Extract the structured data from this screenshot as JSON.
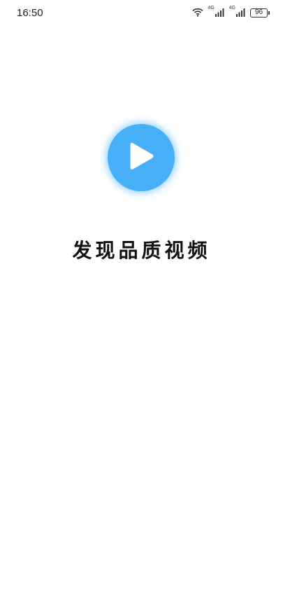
{
  "status_bar": {
    "time": "16:50",
    "network_1": "4G",
    "network_2": "4G",
    "battery": "96",
    "icons": [
      "wifi-icon",
      "signal-icon",
      "signal-icon",
      "battery-icon"
    ]
  },
  "splash": {
    "logo_icon": "play-icon",
    "logo_color": "#47aef8",
    "slogan": "发现品质视频"
  }
}
